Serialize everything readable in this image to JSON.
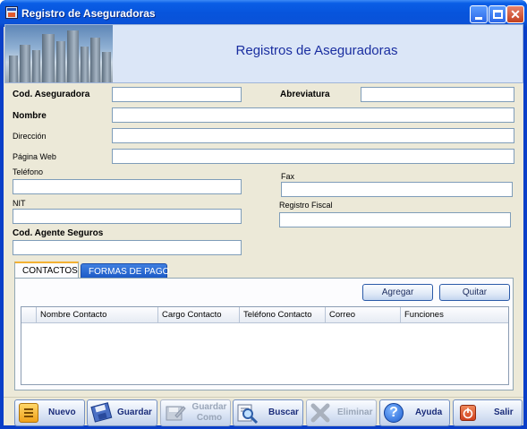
{
  "window": {
    "title": "Registro de Aseguradoras",
    "min_label": "",
    "max_label": "",
    "close_label": "✕"
  },
  "banner": {
    "title": "Registros de Aseguradoras"
  },
  "form": {
    "cod_aseguradora_label": "Cod. Aseguradora",
    "cod_aseguradora_value": "",
    "abreviatura_label": "Abreviatura",
    "abreviatura_value": "",
    "nombre_label": "Nombre",
    "nombre_value": "",
    "direccion_label": "Dirección",
    "direccion_value": "",
    "pagina_web_label": "Página Web",
    "pagina_web_value": "",
    "telefono_label": "Teléfono",
    "telefono_value": "",
    "fax_label": "Fax",
    "fax_value": "",
    "nit_label": "NIT",
    "nit_value": "",
    "registro_fiscal_label": "Registro Fiscal",
    "registro_fiscal_value": "",
    "cod_agente_label": "Cod. Agente Seguros",
    "cod_agente_value": ""
  },
  "tabs": [
    {
      "label": "CONTACTOS",
      "selected": true
    },
    {
      "label": "FORMAS DE PAGO",
      "selected": false
    }
  ],
  "contacts": {
    "add_label": "Agregar",
    "remove_label": "Quitar",
    "columns": [
      "Nombre Contacto",
      "Cargo Contacto",
      "Teléfono Contacto",
      "Correo",
      "Funciones"
    ],
    "rows": []
  },
  "toolbar": {
    "nuevo": "Nuevo",
    "guardar": "Guardar",
    "guardar_como_1": "Guardar",
    "guardar_como_2": "Como",
    "buscar": "Buscar",
    "eliminar": "Eliminar",
    "ayuda": "Ayuda",
    "salir": "Salir"
  },
  "colors": {
    "titlebar": "#0754dc",
    "form_bg": "#ece9d8",
    "banner_title": "#1a2ea0",
    "tab_selected_accent": "#f3b133"
  },
  "icons": {
    "nuevo": "new-icon",
    "guardar": "save-icon",
    "guardar_como": "save-as-icon",
    "buscar": "search-icon",
    "eliminar": "delete-icon",
    "ayuda": "help-icon",
    "salir": "exit-icon"
  }
}
